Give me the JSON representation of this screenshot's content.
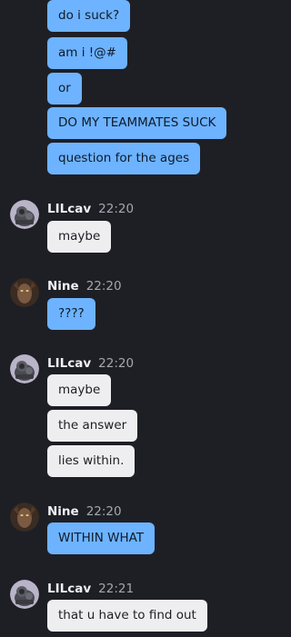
{
  "messages": {
    "m1": "do i suck?",
    "m2": "am i !@#",
    "m3": "or",
    "m4": "DO MY TEAMMATES SUCK",
    "m5": "question for the ages",
    "g1": {
      "name": "LILcav",
      "time": "22:20",
      "msg1": "maybe"
    },
    "g2": {
      "name": "Nine",
      "time": "22:20",
      "msg1": "????"
    },
    "g3": {
      "name": "LILcav",
      "time": "22:20",
      "msg1": "maybe",
      "msg2": "the answer",
      "msg3": "lies within."
    },
    "g4": {
      "name": "Nine",
      "time": "22:20",
      "msg1": "WITHIN WHAT"
    },
    "g5": {
      "name": "LILcav",
      "time": "22:21",
      "msg1": "that u have to find out"
    }
  },
  "colors": {
    "background": "#1e1f25",
    "own_bubble": "#6db3ff",
    "other_bubble": "#eeeef0"
  },
  "icons": {
    "lilcav_avatar": "armored-warrior-avatar",
    "nine_avatar": "dark-face-avatar"
  }
}
